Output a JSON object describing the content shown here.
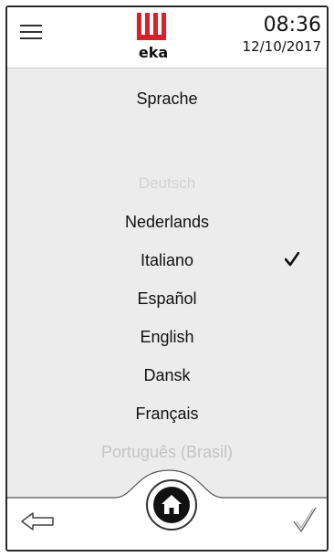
{
  "header": {
    "logo_text": "eka",
    "time": "08:36",
    "date": "12/10/2017"
  },
  "screen": {
    "title": "Sprache"
  },
  "languages": [
    {
      "label": "Deutsch",
      "state": "faded"
    },
    {
      "label": "Nederlands",
      "state": "normal"
    },
    {
      "label": "Italiano",
      "state": "selected"
    },
    {
      "label": "Español",
      "state": "normal"
    },
    {
      "label": "English",
      "state": "normal"
    },
    {
      "label": "Dansk",
      "state": "normal"
    },
    {
      "label": "Français",
      "state": "normal"
    },
    {
      "label": "Português (Brasil)",
      "state": "faded"
    }
  ],
  "icons": {
    "menu": "hamburger-menu-icon",
    "logo": "eka-logo",
    "check": "checkmark-icon",
    "back": "back-arrow-icon",
    "home": "home-icon",
    "confirm": "confirm-check-icon"
  },
  "colors": {
    "logo_red": "#d8222a",
    "content_bg": "#ececec",
    "faded_text": "#c4c4c4"
  }
}
